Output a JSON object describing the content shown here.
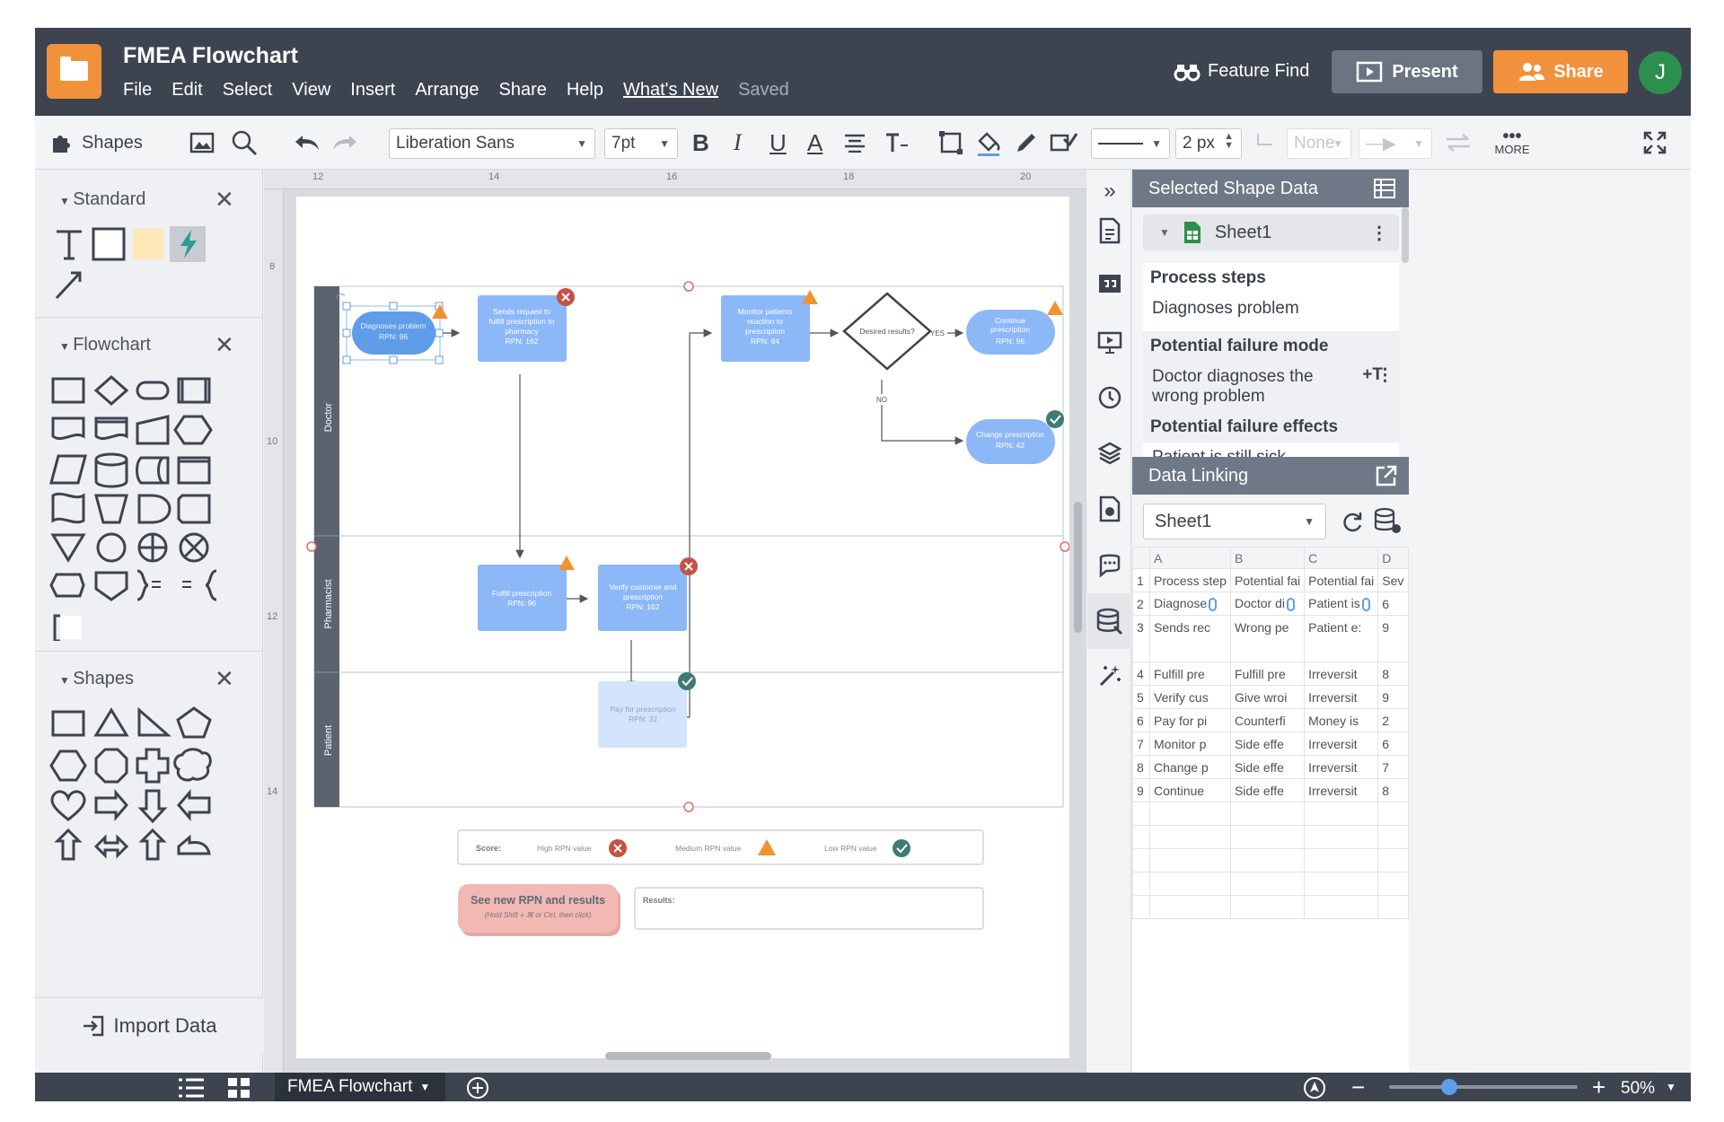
{
  "app": {
    "title": "FMEA Flowchart",
    "avatar_initial": "J",
    "menu": [
      "File",
      "Edit",
      "Select",
      "View",
      "Insert",
      "Arrange",
      "Share",
      "Help",
      "What's New"
    ],
    "status": "Saved",
    "feature_find": "Feature Find",
    "present_label": "Present",
    "share_label": "Share"
  },
  "toolbar": {
    "shapes_label": "Shapes",
    "font_family": "Liberation Sans",
    "font_size": "7pt",
    "bold": "B",
    "italic": "I",
    "underline": "U",
    "font_color": "A",
    "line_width": "2 px",
    "arrow_none": "None",
    "more_label": "MORE"
  },
  "left_panel": {
    "sections": [
      {
        "title": "Standard",
        "close": "✕"
      },
      {
        "title": "Flowchart",
        "close": "✕"
      },
      {
        "title": "Shapes",
        "close": "✕"
      }
    ],
    "import_label": "Import Data"
  },
  "ruler": {
    "top": [
      "12",
      "14",
      "16",
      "18",
      "20"
    ],
    "left": [
      "8",
      "10",
      "12",
      "14"
    ]
  },
  "diagram": {
    "lanes": [
      "Doctor",
      "Pharmacist",
      "Patient"
    ],
    "nodes": {
      "diagnoses": {
        "title": "Diagnoses problem",
        "rpn": "RPN: 96"
      },
      "sends": {
        "title": "Sends request to fulfill prescription to pharmacy",
        "rpn": "RPN: 162"
      },
      "monitor": {
        "title": "Monitor patients reaction to prescription",
        "rpn": "RPN: 84"
      },
      "desired": {
        "title": "Desired results?"
      },
      "continue": {
        "title": "Continue prescription",
        "rpn": "RPN: 96"
      },
      "change": {
        "title": "Change prescription",
        "rpn": "RPN: 42"
      },
      "fulfill": {
        "title": "Fulfill prescription",
        "rpn": "RPN: 96"
      },
      "verify": {
        "title": "Verify customer and prescription",
        "rpn": "RPN: 162"
      },
      "pay": {
        "title": "Pay for prescription",
        "rpn": "RPN: 32"
      }
    },
    "yes_label": "YES",
    "no_label": "NO",
    "legend": {
      "score": "Score:",
      "high": "High RPN value",
      "medium": "Medium RPN value",
      "low": "Low RPN value"
    },
    "cta_title": "See new RPN and results",
    "cta_hint": "(Hold Shift + ⌘ or Ctrl, then click)",
    "results_label": "Results:",
    "colors": {
      "node": "#8cb8f8",
      "node_light": "#b9d4fb",
      "lane_header": "#5b636e",
      "high": "#c65245",
      "medium": "#f0932f",
      "low": "#3f7b72",
      "cta": "#f1b8b4"
    }
  },
  "right_panel": {
    "selected_title": "Selected Shape Data",
    "sheet_name": "Sheet1",
    "fields": [
      {
        "label": "Process steps",
        "value": "Diagnoses problem"
      },
      {
        "label": "Potential failure mode",
        "value": "Doctor diagnoses the wrong problem"
      },
      {
        "label": "Potential failure effects",
        "value": "Patient is still sick"
      }
    ],
    "data_linking_title": "Data Linking",
    "sheet_select": "Sheet1",
    "columns": [
      "A",
      "B",
      "C",
      "D"
    ],
    "rows": [
      {
        "n": "1",
        "a": "Process step",
        "b": "Potential fai",
        "c": "Potential fai",
        "d": "Sev"
      },
      {
        "n": "2",
        "a": "Diagnose",
        "b": "Doctor di",
        "c": "Patient is",
        "d": "6"
      },
      {
        "n": "3",
        "a": "Sends rec",
        "b": "Wrong pe",
        "c": "Patient e:",
        "d": "9"
      },
      {
        "n": "4",
        "a": "Fulfill pre",
        "b": "Fulfill pre",
        "c": "Irreversit",
        "d": "8"
      },
      {
        "n": "5",
        "a": "Verify cus",
        "b": "Give wroi",
        "c": "Irreversit",
        "d": "9"
      },
      {
        "n": "6",
        "a": "Pay for pi",
        "b": "Counterfi",
        "c": "Money is",
        "d": "2"
      },
      {
        "n": "7",
        "a": "Monitor p",
        "b": "Side effe",
        "c": "Irreversit",
        "d": "6"
      },
      {
        "n": "8",
        "a": "Change p",
        "b": "Side effe",
        "c": "Irreversit",
        "d": "7"
      },
      {
        "n": "9",
        "a": "Continue",
        "b": "Side effe",
        "c": "Irreversit",
        "d": "8"
      }
    ]
  },
  "bottom_bar": {
    "page_tab": "FMEA Flowchart",
    "zoom": "50%"
  }
}
